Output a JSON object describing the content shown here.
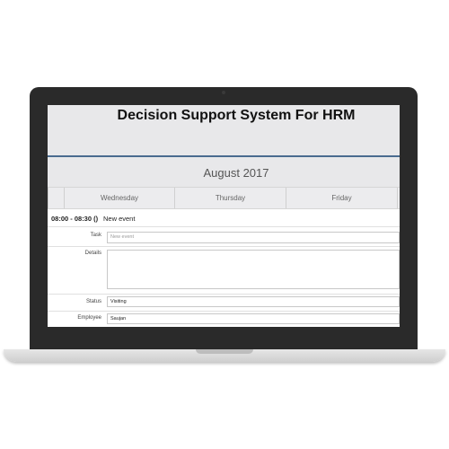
{
  "app": {
    "title": "Decision Support System For HRM"
  },
  "calendar": {
    "month": "August 2017",
    "days": [
      "Wednesday",
      "Thursday",
      "Friday"
    ]
  },
  "event": {
    "time": "08:00 - 08:30 ()",
    "name": "New event"
  },
  "form": {
    "task_label": "Task",
    "task_placeholder": "New event",
    "details_label": "Details",
    "details_value": "",
    "status_label": "Status",
    "status_value": "Visiting",
    "employee_label": "Employee",
    "employee_value": "Saujan"
  },
  "colors": {
    "header_bg": "#e8e8ea",
    "accent_line": "#4a6b8f",
    "laptop_bezel": "#2a2a2a"
  }
}
